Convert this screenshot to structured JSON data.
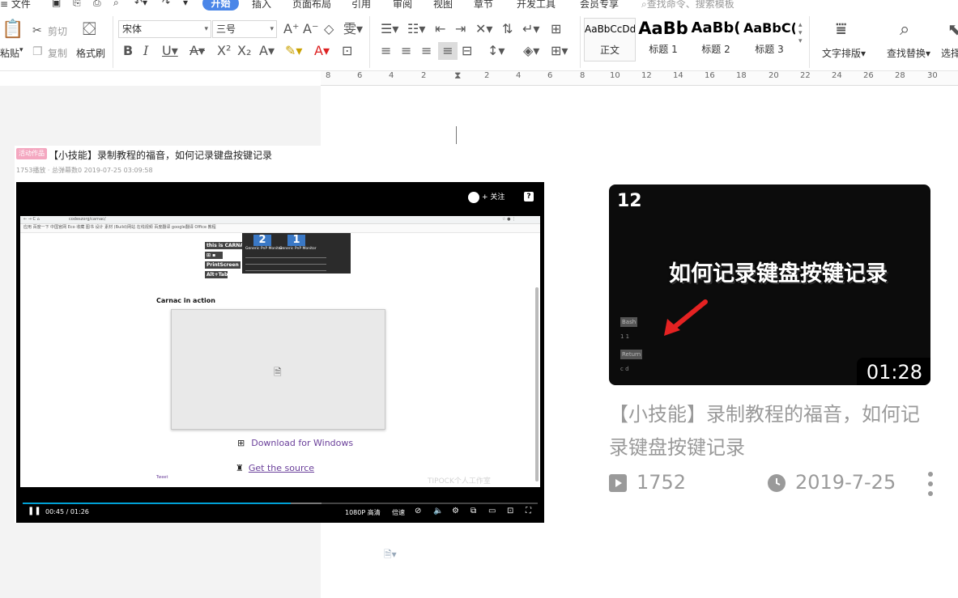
{
  "menu": {
    "file": "文件",
    "tabs": [
      "开始",
      "插入",
      "页面布局",
      "引用",
      "审阅",
      "视图",
      "章节",
      "开发工具",
      "会员专享"
    ],
    "search_placeholder": "查找命令、搜索模板"
  },
  "ribbon": {
    "cut": "剪切",
    "copy": "复制",
    "paste": "粘贴",
    "format_painter": "格式刷",
    "font_name": "宋体",
    "font_size": "三号",
    "styles": [
      {
        "sample": "AaBbCcDd",
        "label": "正文"
      },
      {
        "sample": "AaBb",
        "label": "标题 1"
      },
      {
        "sample": "AaBb(",
        "label": "标题 2"
      },
      {
        "sample": "AaBbC(",
        "label": "标题 3"
      }
    ],
    "text_layout": "文字排版",
    "find_replace": "查找替换",
    "select": "选择"
  },
  "ruler": {
    "ticks": [
      "8",
      "6",
      "4",
      "2",
      "2",
      "4",
      "6",
      "8",
      "10",
      "12",
      "14",
      "16",
      "18",
      "20",
      "22",
      "24",
      "26",
      "28",
      "30"
    ]
  },
  "embed": {
    "activity_tag": "活动作品",
    "title": "【小技能】录制教程的福音，如何记录键盘按键记录",
    "meta": "1753播放 · 总弹幕数0   2019-07-25 03:09:58",
    "follow_label": "+ 关注",
    "help": "?",
    "screen": {
      "url": "codeszorg/carnac/",
      "bookmarks": "应用   百度一下   中国官网   Eco   收藏   图书   设计   素材   (Build)网站   在线视频   百度翻译   google翻译   Office   教程",
      "this_is": "this is CARNAC",
      "printscreen": "PrintScreen",
      "monitor_1": "2",
      "monitor_2": "1",
      "monitor_label_1": "Generic PnP Monitor",
      "monitor_label_2": "Generic PnP Monitor",
      "section_heading": "Carnac in action",
      "download": "Download for Windows",
      "get_source": "Get the source",
      "tweet": "Tweet",
      "watermark": "TIPOCK个人工作室"
    },
    "controls": {
      "current": "00:45",
      "total": "01:26",
      "quality": "1080P 高清",
      "speed": "倍速",
      "progress": 0.52
    }
  },
  "card": {
    "thumb_number": "12",
    "thumb_title": "如何记录键盘按键记录",
    "thumb_key_1": "Bash",
    "thumb_key_2": "Return",
    "duration": "01:28",
    "title": "【小技能】录制教程的福音，如何记录键盘按键记录",
    "plays": "1752",
    "date": "2019-7-25"
  },
  "colors": {
    "accent": "#4a86e8",
    "link": "#6a3f9a",
    "progress": "#00a1d6",
    "meta_gray": "#9a9a9a"
  }
}
